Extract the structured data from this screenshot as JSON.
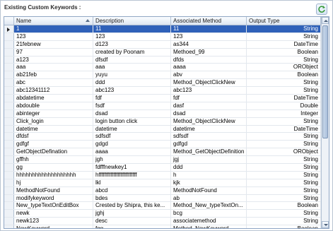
{
  "panel": {
    "title": "Existing Custom Keywords :"
  },
  "grid": {
    "columns": [
      "Name",
      "Description",
      "Associated Method",
      "Output Type"
    ],
    "sort_column": "Name",
    "rows": [
      [
        "1",
        "11",
        "11",
        "String"
      ],
      [
        "123",
        "123",
        "123",
        "String"
      ],
      [
        "21febnew",
        "d123",
        "as344",
        "DateTime"
      ],
      [
        "97",
        "created by Poonam",
        "Methoed_99",
        "Boolean"
      ],
      [
        "a123",
        "dfsdf",
        "dfds",
        "String"
      ],
      [
        "aaa",
        "aaa",
        "aaaa",
        "ORObject"
      ],
      [
        "ab21feb",
        "yuyu",
        "abv",
        "Boolean"
      ],
      [
        "abc",
        "ddd",
        "Method_ObjectClickNew",
        "String"
      ],
      [
        "abc12341112",
        "abc123",
        "abc123",
        "String"
      ],
      [
        "abdatetime",
        "fdf",
        "fdf",
        "DateTime"
      ],
      [
        "abdouble",
        "fsdf",
        "dasf",
        "Double"
      ],
      [
        "abinteger",
        "dsad",
        "dsad",
        "Integer"
      ],
      [
        "Click_login",
        "login button click",
        "Method_ObjectClickNew",
        "String"
      ],
      [
        "datetime",
        "datetime",
        "datetime",
        "DateTime"
      ],
      [
        "dfdsf",
        "sdfsdf",
        "sdfsdf",
        "String"
      ],
      [
        "gdfgf",
        "gdgd",
        "gdfgd",
        "String"
      ],
      [
        "GetObjectDefination",
        "aaaa",
        "Method_GetObjectDefinition",
        "ORObject"
      ],
      [
        "gffhh",
        "jgh",
        "jgj",
        "String"
      ],
      [
        "gg",
        "fdfffnewkey1",
        "ddd",
        "String"
      ],
      [
        "hhhhhhhhhhhhhhhhhhh",
        "hffffffffffffffffffffffffff",
        "h",
        "String"
      ],
      [
        "hj",
        "lkl",
        "kjk",
        "String"
      ],
      [
        "MethodNotFound",
        "abcd",
        "MethodNotFound",
        "String"
      ],
      [
        "modifykeyword",
        "bdes",
        "ab",
        "String"
      ],
      [
        "New_typeTextOnEditBox",
        "Crested by Shipra, this ke...",
        "Method_New_typeTextOn...",
        "Boolean"
      ],
      [
        "newk",
        "jghj",
        "bcg",
        "String"
      ],
      [
        "newk123",
        "desc",
        "associatemethod",
        "String"
      ],
      [
        "NewKeyword",
        "fgg",
        "Method_NewKeyword",
        "Boolean"
      ]
    ],
    "selected_row_index": 0
  },
  "icons": {
    "refresh": "refresh-icon"
  },
  "colors": {
    "selection": "#2f61b9",
    "header_bg": "#dde6f1",
    "refresh_green": "#3a9b3a"
  }
}
